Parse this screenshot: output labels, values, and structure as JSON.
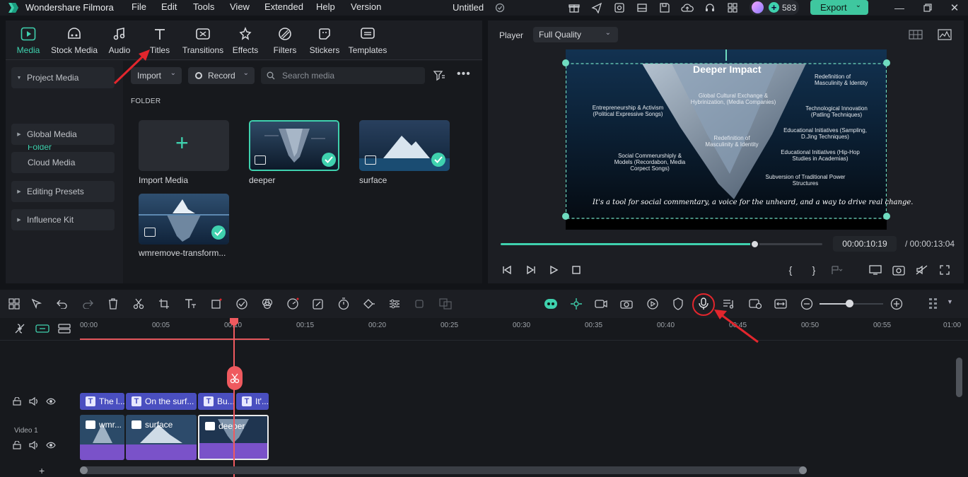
{
  "app": {
    "name": "Wondershare Filmora",
    "menu": [
      "File",
      "Edit",
      "Tools",
      "View",
      "Extended",
      "Help",
      "Version"
    ],
    "document_title": "Untitled",
    "credits": "583",
    "export_label": "Export"
  },
  "tabs": [
    {
      "label": "Media",
      "icon": "media-icon"
    },
    {
      "label": "Stock Media",
      "icon": "stock-media-icon"
    },
    {
      "label": "Audio",
      "icon": "audio-icon"
    },
    {
      "label": "Titles",
      "icon": "titles-icon"
    },
    {
      "label": "Transitions",
      "icon": "transitions-icon"
    },
    {
      "label": "Effects",
      "icon": "effects-icon"
    },
    {
      "label": "Filters",
      "icon": "filters-icon"
    },
    {
      "label": "Stickers",
      "icon": "stickers-icon"
    },
    {
      "label": "Templates",
      "icon": "templates-icon"
    }
  ],
  "sidebar": {
    "project_media": "Project Media",
    "folder": "Folder",
    "global_media": "Global Media",
    "cloud_media": "Cloud Media",
    "editing_presets": "Editing Presets",
    "influence_kit": "Influence Kit"
  },
  "media_toolbar": {
    "import_label": "Import",
    "record_label": "Record",
    "search_placeholder": "Search media"
  },
  "media": {
    "folder_heading": "FOLDER",
    "import_tile_label": "Import Media",
    "items": [
      {
        "name": "deeper",
        "selected": true
      },
      {
        "name": "surface",
        "selected": false
      },
      {
        "name": "wmremove-transform...",
        "selected": false
      }
    ]
  },
  "player": {
    "label": "Player",
    "quality": "Full Quality",
    "current_time": "00:00:10:19",
    "total_time": "/ 00:00:13:04",
    "progress": 0.79,
    "frame": {
      "title": "Deeper Impact",
      "caption": "It's a tool for social commentary, a voice for the unheard, and a way to drive real change.",
      "annotations": [
        "Redefinition of Masculinity & Identity",
        "Entrepreneurship & Activism (Political Expressive Songs)",
        "Global Cultural Exchange & Hybrinization, (Media Companies)",
        "Technological Innovation (Patling Techniques)",
        "Redefinition of Masculinity & Identity",
        "Educational Initiatives (Sampling, D.Jing Techniques)",
        "Social Commerurshiply & Models (Recordabon, Media Corpect Songs)",
        "Educational Initiatives (Hip-Hop Studies in Academias)",
        "Subversion of Traditional Power Structures"
      ]
    }
  },
  "timeline": {
    "ruler": [
      "00:00",
      "00:05",
      "00:10",
      "00:15",
      "00:20",
      "00:25",
      "00:30",
      "00:35",
      "00:40",
      "00:45",
      "00:50",
      "00:55",
      "01:00"
    ],
    "track_video_label": "Video 1",
    "title_clips": [
      "The l...",
      "On the surf...",
      "Bu...",
      "It'..."
    ],
    "video_clips": [
      "wmr...",
      "surface",
      "deeper"
    ]
  },
  "colors": {
    "accent": "#3fd1ae",
    "title_clip": "#4a4fc0",
    "video_strip": "#7a52c9",
    "annotation": "#e2262d"
  }
}
